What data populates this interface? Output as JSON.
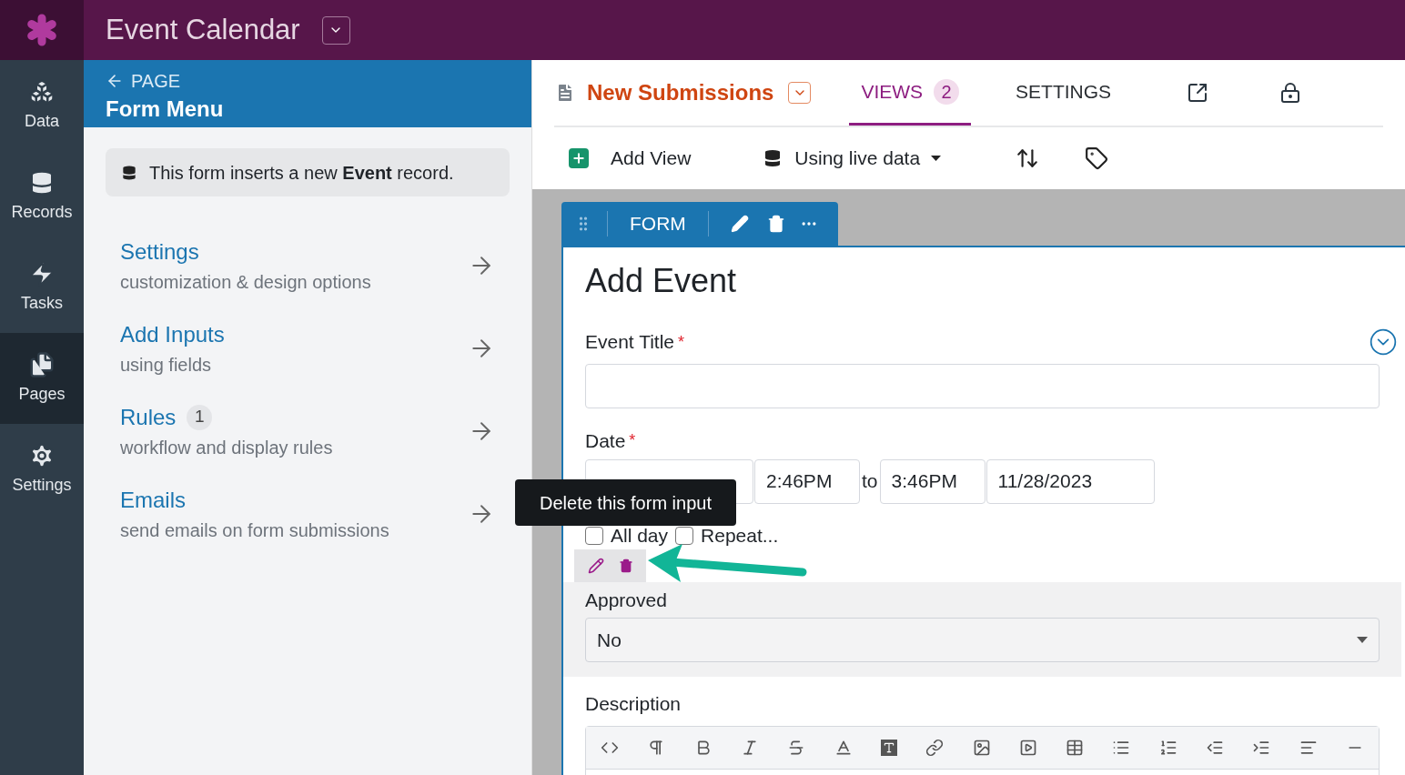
{
  "app": {
    "title": "Event Calendar"
  },
  "nav": [
    {
      "label": "Data",
      "selected": false
    },
    {
      "label": "Records",
      "selected": false
    },
    {
      "label": "Tasks",
      "selected": false
    },
    {
      "label": "Pages",
      "selected": true
    },
    {
      "label": "Settings",
      "selected": false
    }
  ],
  "panel": {
    "back_label": "PAGE",
    "title": "Form Menu",
    "info": "This form inserts a new **Event** record.",
    "items": [
      {
        "title": "Settings",
        "subtitle": "customization & design options"
      },
      {
        "title": "Add Inputs",
        "subtitle": "using fields"
      },
      {
        "title": "Rules",
        "badge": "1",
        "subtitle": "workflow and display rules"
      },
      {
        "title": "Emails",
        "subtitle": "send emails on form submissions"
      }
    ]
  },
  "page": {
    "title": "New Submissions",
    "tabs": [
      {
        "label": "VIEWS",
        "badge": "2",
        "selected": true
      },
      {
        "label": "SETTINGS",
        "selected": false
      }
    ],
    "toolbar": {
      "add_view": "Add View",
      "data_source": "Using live data"
    }
  },
  "view": {
    "tab_label": "FORM",
    "title": "Add Event",
    "fields": [
      {
        "kind": "text",
        "label": "Event Title",
        "required_mark": "*",
        "hovered": false
      },
      {
        "kind": "datetime",
        "label": "Date",
        "required_mark": "*",
        "hovered": false,
        "start_time": "2:46PM",
        "separator": "to",
        "end_time": "3:46PM",
        "end_date": "11/28/2023",
        "options": [
          {
            "label": "All day",
            "checked": false
          },
          {
            "label": "Repeat...",
            "checked": false
          }
        ]
      },
      {
        "kind": "select",
        "label": "Approved",
        "value": "No",
        "hovered": true
      },
      {
        "kind": "richtext",
        "label": "Description",
        "hovered": false
      }
    ]
  },
  "tooltip": {
    "text": "Delete this form input"
  }
}
